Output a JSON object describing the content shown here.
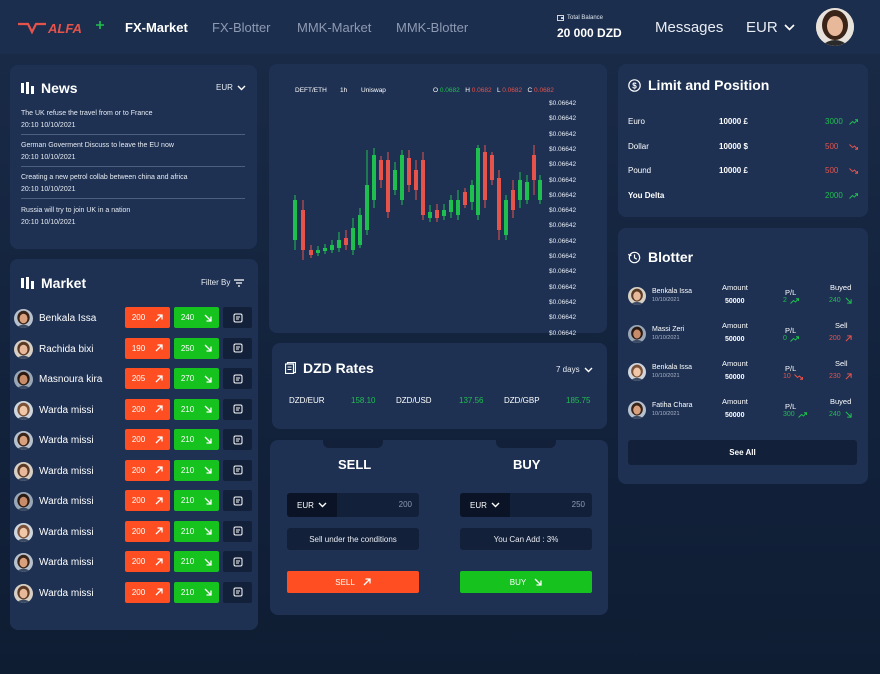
{
  "header": {
    "brand": "ALFA",
    "nav": [
      "FX-Market",
      "FX-Blotter",
      "MMK-Market",
      "MMK-Blotter"
    ],
    "balance_label": "Total Balance",
    "balance_value": "20 000 DZD",
    "messages": "Messages",
    "currency": "EUR"
  },
  "news": {
    "title": "News",
    "currency": "EUR",
    "items": [
      {
        "text": "The UK refuse the travel from or to France",
        "time": "20:10 10/10/2021"
      },
      {
        "text": "German Goverment Discuss to leave the EU now",
        "time": "20:10 10/10/2021"
      },
      {
        "text": "Creating a new petrol collab between china and africa",
        "time": "20:10 10/10/2021"
      },
      {
        "text": "Russia will try to join UK in a nation",
        "time": "20:10 10/10/2021"
      }
    ]
  },
  "market": {
    "title": "Market",
    "filter": "Filter By",
    "rows": [
      {
        "name": "Benkala Issa",
        "sell": "200",
        "buy": "240"
      },
      {
        "name": "Rachida bixi",
        "sell": "190",
        "buy": "250"
      },
      {
        "name": "Masnoura kira",
        "sell": "205",
        "buy": "270"
      },
      {
        "name": "Warda missi",
        "sell": "200",
        "buy": "210"
      },
      {
        "name": "Warda missi",
        "sell": "200",
        "buy": "210"
      },
      {
        "name": "Warda missi",
        "sell": "200",
        "buy": "210"
      },
      {
        "name": "Warda missi",
        "sell": "200",
        "buy": "210"
      },
      {
        "name": "Warda missi",
        "sell": "200",
        "buy": "210"
      },
      {
        "name": "Warda missi",
        "sell": "200",
        "buy": "210"
      },
      {
        "name": "Warda missi",
        "sell": "200",
        "buy": "210"
      }
    ]
  },
  "chart": {
    "pair": "DEFT/ETH",
    "interval": "1h",
    "exchange": "Uniswap",
    "o_label": "O",
    "o_val": "0.0682",
    "h_label": "H",
    "h_val": "0.0682",
    "l_label": "L",
    "l_val": "0.0682",
    "c_label": "C",
    "c_val": "0.0682",
    "ticks": [
      "$0.06642",
      "$0.06642",
      "$0.06642",
      "$0.06642",
      "$0.06642",
      "$0.06642",
      "$0.06642",
      "$0.06642",
      "$0.06642",
      "$0.06642",
      "$0.06642",
      "$0.06642",
      "$0.06642",
      "$0.06642",
      "$0.06642",
      "$0.06642"
    ],
    "up_color": "#1fbf4f",
    "down_color": "#e5534b"
  },
  "rates": {
    "title": "DZD Rates",
    "period": "7 days",
    "items": [
      {
        "pair": "DZD/EUR",
        "value": "158.10"
      },
      {
        "pair": "DZD/USD",
        "value": "137.56"
      },
      {
        "pair": "DZD/GBP",
        "value": "185.75"
      }
    ]
  },
  "trade": {
    "sell_title": "SELL",
    "buy_title": "BUY",
    "sell_currency": "EUR",
    "sell_amount": "200",
    "buy_currency": "EUR",
    "buy_amount": "250",
    "sell_note": "Sell under the conditions",
    "buy_note": "You Can Add : 3%",
    "sell_button": "SELL",
    "buy_button": "BUY"
  },
  "limit": {
    "title": "Limit and Position",
    "rows": [
      {
        "label": "Euro",
        "amount": "10000 £",
        "value": "3000",
        "dir": "up"
      },
      {
        "label": "Dollar",
        "amount": "10000 $",
        "value": "500",
        "dir": "down"
      },
      {
        "label": "Pound",
        "amount": "10000 £",
        "value": "500",
        "dir": "down"
      },
      {
        "label": "You Delta",
        "amount": "",
        "value": "2000",
        "dir": "up"
      }
    ]
  },
  "blotter": {
    "title": "Blotter",
    "see_all": "See All",
    "rows": [
      {
        "name": "Benkala Issa",
        "date": "10/10/2021",
        "amount_label": "Amount",
        "amount": "50000",
        "pl_label": "P/L",
        "pl": "2",
        "pl_dir": "up",
        "action": "Buyed",
        "value": "240",
        "value_dir": "up"
      },
      {
        "name": "Massi Zeri",
        "date": "10/10/2021",
        "amount_label": "Amount",
        "amount": "50000",
        "pl_label": "P/L",
        "pl": "0",
        "pl_dir": "up",
        "action": "Sell",
        "value": "200",
        "value_dir": "down"
      },
      {
        "name": "Benkala Issa",
        "date": "10/10/2021",
        "amount_label": "Amount",
        "amount": "50000",
        "pl_label": "P/L",
        "pl": "10",
        "pl_dir": "down",
        "action": "Sell",
        "value": "230",
        "value_dir": "down"
      },
      {
        "name": "Fatiha Chara",
        "date": "10/10/2021",
        "amount_label": "Amount",
        "amount": "50000",
        "pl_label": "P/L",
        "pl": "300",
        "pl_dir": "up",
        "action": "Buyed",
        "value": "240",
        "value_dir": "up"
      }
    ]
  }
}
